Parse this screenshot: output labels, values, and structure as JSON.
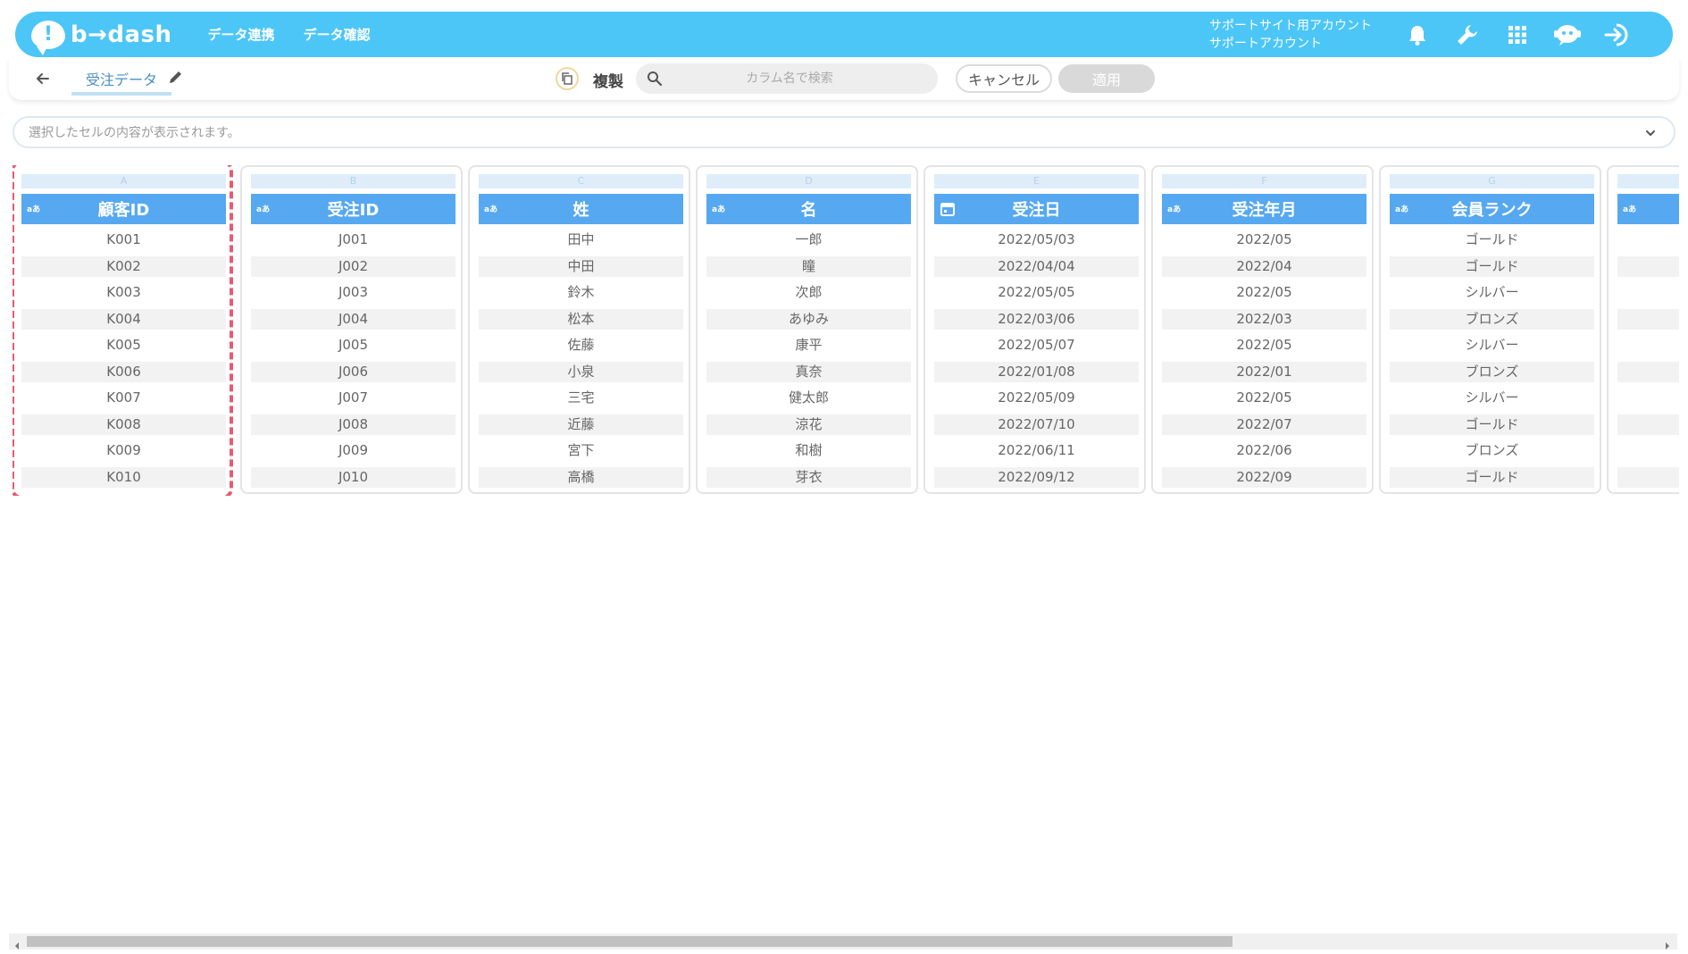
{
  "header": {
    "logo_text": "b→dash",
    "nav": [
      "データ連携",
      "データ確認"
    ],
    "account_line1": "サポートサイト用アカウント",
    "account_line2": "サポートアカウント",
    "icons": [
      "bell-icon",
      "wrench-icon",
      "grid-icon",
      "chatbot-icon",
      "logout-icon"
    ]
  },
  "toolbar": {
    "title": "受注データ",
    "duplicate_label": "複製",
    "search_placeholder": "カラム名で検索",
    "cancel_label": "キャンセル",
    "apply_label": "適用"
  },
  "cellbar": {
    "placeholder": "選択したセルの内容が表示されます。"
  },
  "columns": [
    {
      "letter": "A",
      "name": "顧客ID",
      "type": "text",
      "type_label": "aあ",
      "selected": true,
      "values": [
        "K001",
        "K002",
        "K003",
        "K004",
        "K005",
        "K006",
        "K007",
        "K008",
        "K009",
        "K010"
      ]
    },
    {
      "letter": "B",
      "name": "受注ID",
      "type": "text",
      "type_label": "aあ",
      "selected": false,
      "values": [
        "J001",
        "J002",
        "J003",
        "J004",
        "J005",
        "J006",
        "J007",
        "J008",
        "J009",
        "J010"
      ]
    },
    {
      "letter": "C",
      "name": "姓",
      "type": "text",
      "type_label": "aあ",
      "selected": false,
      "values": [
        "田中",
        "中田",
        "鈴木",
        "松本",
        "佐藤",
        "小泉",
        "三宅",
        "近藤",
        "宮下",
        "高橋"
      ]
    },
    {
      "letter": "D",
      "name": "名",
      "type": "text",
      "type_label": "aあ",
      "selected": false,
      "values": [
        "一郎",
        "瞳",
        "次郎",
        "あゆみ",
        "康平",
        "真奈",
        "健太郎",
        "涼花",
        "和樹",
        "芽衣"
      ]
    },
    {
      "letter": "E",
      "name": "受注日",
      "type": "date",
      "type_label": "",
      "selected": false,
      "values": [
        "2022/05/03",
        "2022/04/04",
        "2022/05/05",
        "2022/03/06",
        "2022/05/07",
        "2022/01/08",
        "2022/05/09",
        "2022/07/10",
        "2022/06/11",
        "2022/09/12"
      ]
    },
    {
      "letter": "F",
      "name": "受注年月",
      "type": "text",
      "type_label": "aあ",
      "selected": false,
      "values": [
        "2022/05",
        "2022/04",
        "2022/05",
        "2022/03",
        "2022/05",
        "2022/01",
        "2022/05",
        "2022/07",
        "2022/06",
        "2022/09"
      ]
    },
    {
      "letter": "G",
      "name": "会員ランク",
      "type": "text",
      "type_label": "aあ",
      "selected": false,
      "values": [
        "ゴールド",
        "ゴールド",
        "シルバー",
        "ブロンズ",
        "シルバー",
        "ブロンズ",
        "シルバー",
        "ゴールド",
        "ブロンズ",
        "ゴールド"
      ]
    },
    {
      "letter": "",
      "name": "",
      "type": "text",
      "type_label": "aあ",
      "selected": false,
      "values": [
        "",
        "",
        "",
        "",
        "",
        "",
        "",
        "",
        "",
        ""
      ]
    }
  ]
}
